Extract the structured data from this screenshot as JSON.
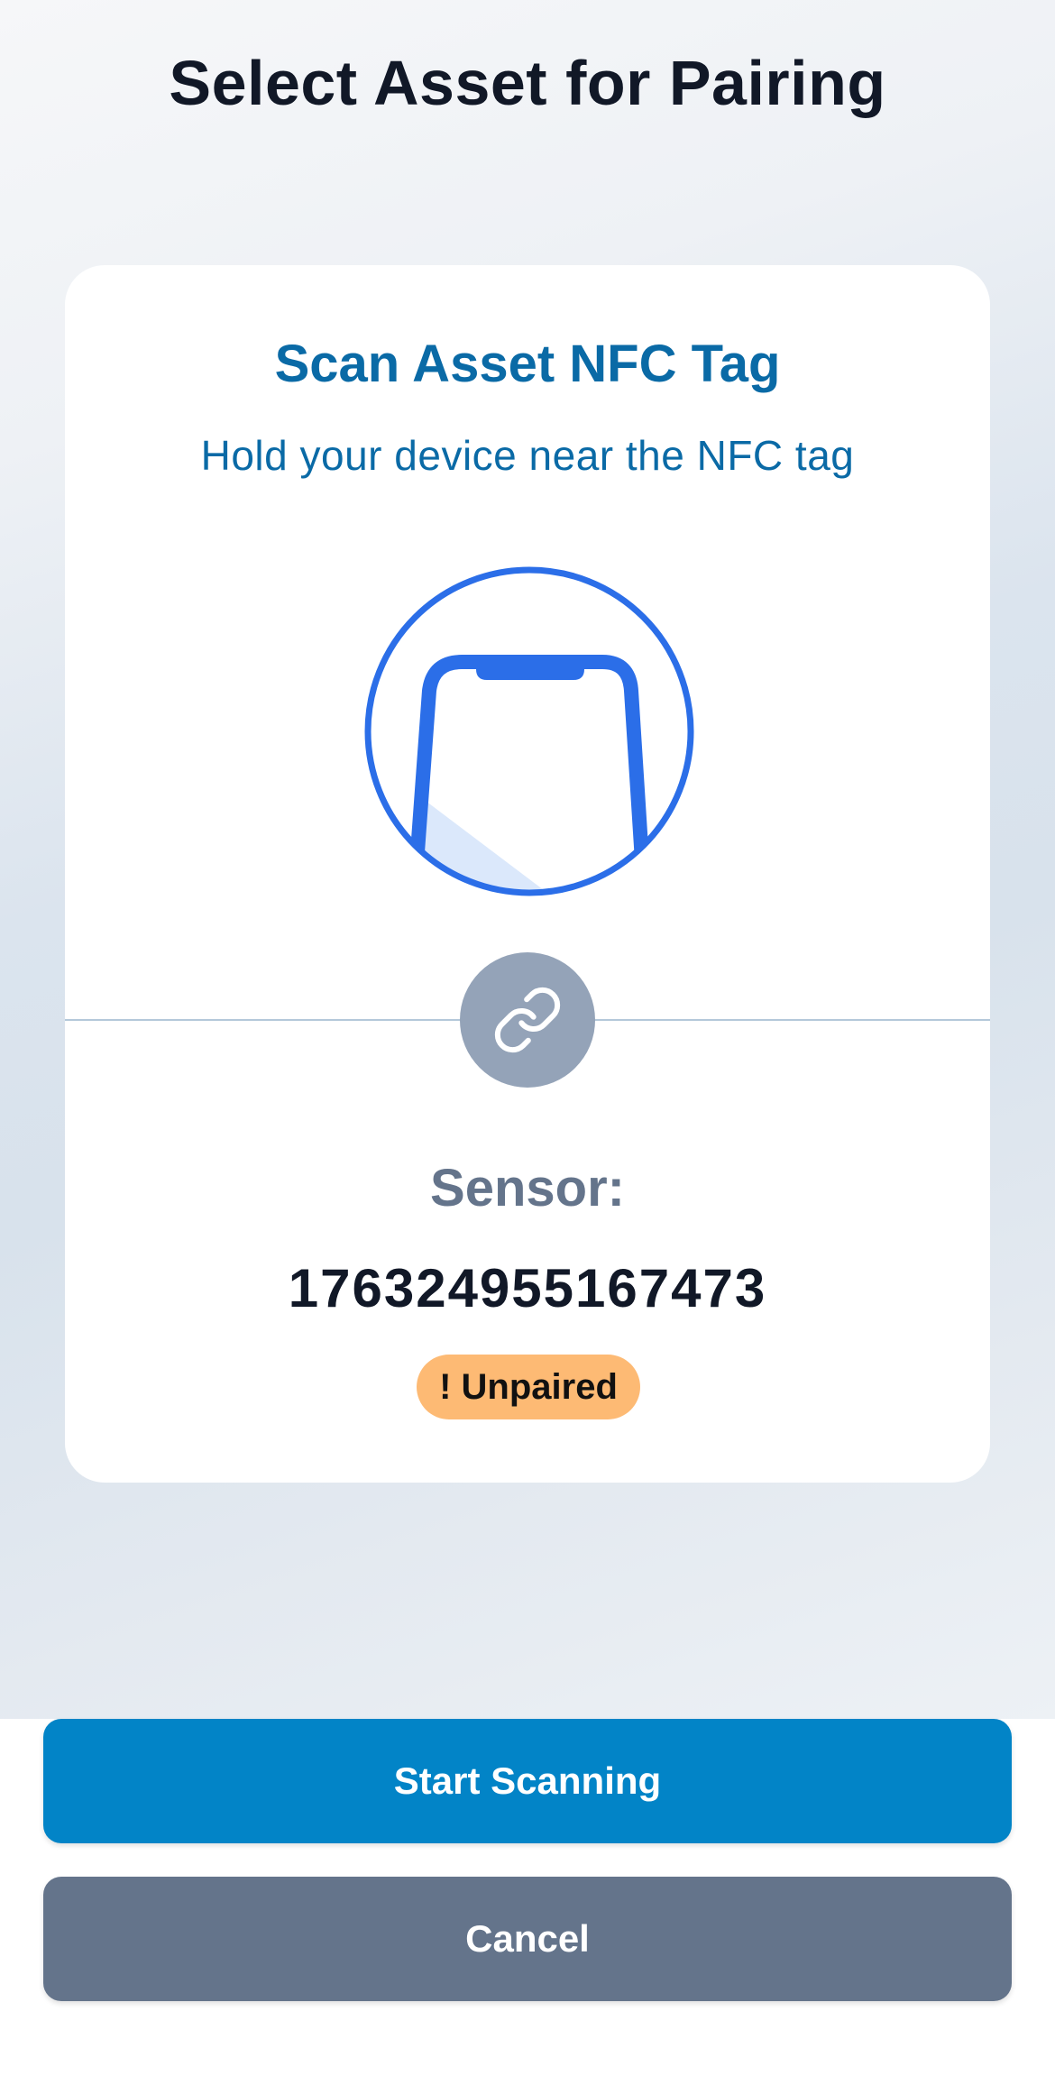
{
  "header": {
    "title": "Select Asset for Pairing"
  },
  "scan_card": {
    "title": "Scan Asset NFC Tag",
    "subtitle": "Hold your device near the NFC tag",
    "illustration_icon": "phone-nfc-icon",
    "link_icon": "link-icon",
    "sensor_label": "Sensor:",
    "sensor_id": "176324955167473",
    "status_badge": "! Unpaired"
  },
  "actions": {
    "start_label": "Start Scanning",
    "cancel_label": "Cancel"
  },
  "colors": {
    "primary": "#0284c7",
    "secondary": "#64748b",
    "accent_text": "#0a6aa6",
    "illustration": "#2b6ee8",
    "badge_unpaired": "#fdba74"
  }
}
